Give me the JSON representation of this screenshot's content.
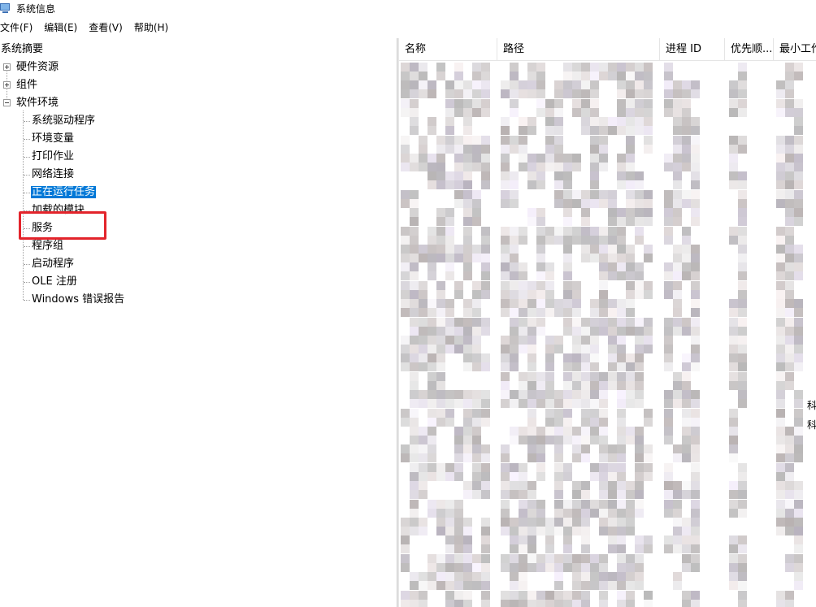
{
  "window": {
    "title": "系统信息"
  },
  "menu": {
    "items": [
      "文件(F)",
      "编辑(E)",
      "查看(V)",
      "帮助(H)"
    ]
  },
  "tree": {
    "root": "系统摘要",
    "hardware": "硬件资源",
    "components": "组件",
    "software": "软件环境",
    "children": [
      "系统驱动程序",
      "环境变量",
      "打印作业",
      "网络连接",
      "正在运行任务",
      "加载的模块",
      "服务",
      "程序组",
      "启动程序",
      "OLE 注册",
      "Windows 错误报告"
    ]
  },
  "table": {
    "columns": [
      "名称",
      "路径",
      "进程 ID",
      "优先顺...",
      "最小工作"
    ],
    "edge_chars": [
      "科",
      "科"
    ]
  },
  "colors": {
    "selection": "#0078d7",
    "highlight": "#e3242b"
  },
  "icons": {
    "app": "system-info-icon",
    "expand": "plus-icon",
    "collapse": "minus-icon"
  }
}
